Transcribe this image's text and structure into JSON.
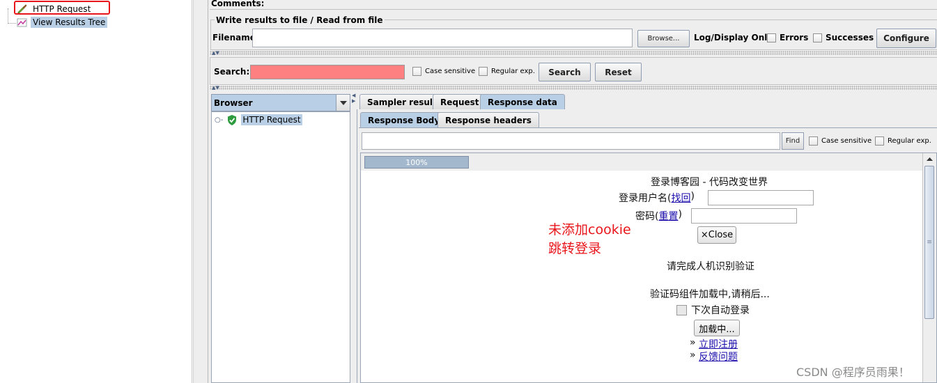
{
  "tree": {
    "items": [
      {
        "label": "HTTP Request",
        "icon": "pipette-icon",
        "highlighted": true
      },
      {
        "label": "View Results Tree",
        "icon": "chart-icon",
        "highlighted": false
      }
    ]
  },
  "comments_label": "Comments:",
  "file_section": {
    "title": "Write results to file / Read from file",
    "filename_label": "Filename",
    "filename_value": "",
    "browse_label": "Browse...",
    "log_display_label": "Log/Display Only:",
    "errors_label": "Errors",
    "successes_label": "Successes",
    "configure_label": "Configure"
  },
  "search": {
    "label": "Search:",
    "value": "",
    "case_sensitive_label": "Case sensitive",
    "regex_label": "Regular exp.",
    "search_button": "Search",
    "reset_button": "Reset",
    "field_color": "#ff8080"
  },
  "browser": {
    "dropdown_label": "Browser",
    "samples": [
      {
        "label": "HTTP Request",
        "status": "success",
        "icon": "shield-check-icon"
      }
    ]
  },
  "result_tabs": {
    "main": [
      "Sampler result",
      "Request",
      "Response data"
    ],
    "active_main": "Response data",
    "sub": [
      "Response Body",
      "Response headers"
    ],
    "active_sub": "Response Body"
  },
  "find_bar": {
    "value": "",
    "find_button": "Find",
    "case_sensitive_label": "Case sensitive",
    "regex_label": "Regular exp."
  },
  "progress": {
    "label": "100%",
    "value": 100
  },
  "response_page": {
    "title": "登录博客园 - 代码改变世界",
    "username_label": "登录用户名(",
    "username_link": "找回",
    "username_close": ")",
    "password_label": "密码(",
    "password_link": "重置",
    "password_close": ")",
    "close_button": "×Close",
    "captcha_prompt": "请完成人机识别验证",
    "captcha_loading": "验证码组件加载中,请稍后...",
    "remember_label": "下次自动登录",
    "loading_button": "加载中...",
    "register_prefix": "» ",
    "register_link": "立即注册",
    "feedback_prefix": "» ",
    "feedback_link": "反馈问题"
  },
  "annotation": {
    "line1": "未添加cookie",
    "line2": "跳转登录",
    "color": "#e8161b"
  },
  "watermark": "CSDN @程序员雨果！"
}
